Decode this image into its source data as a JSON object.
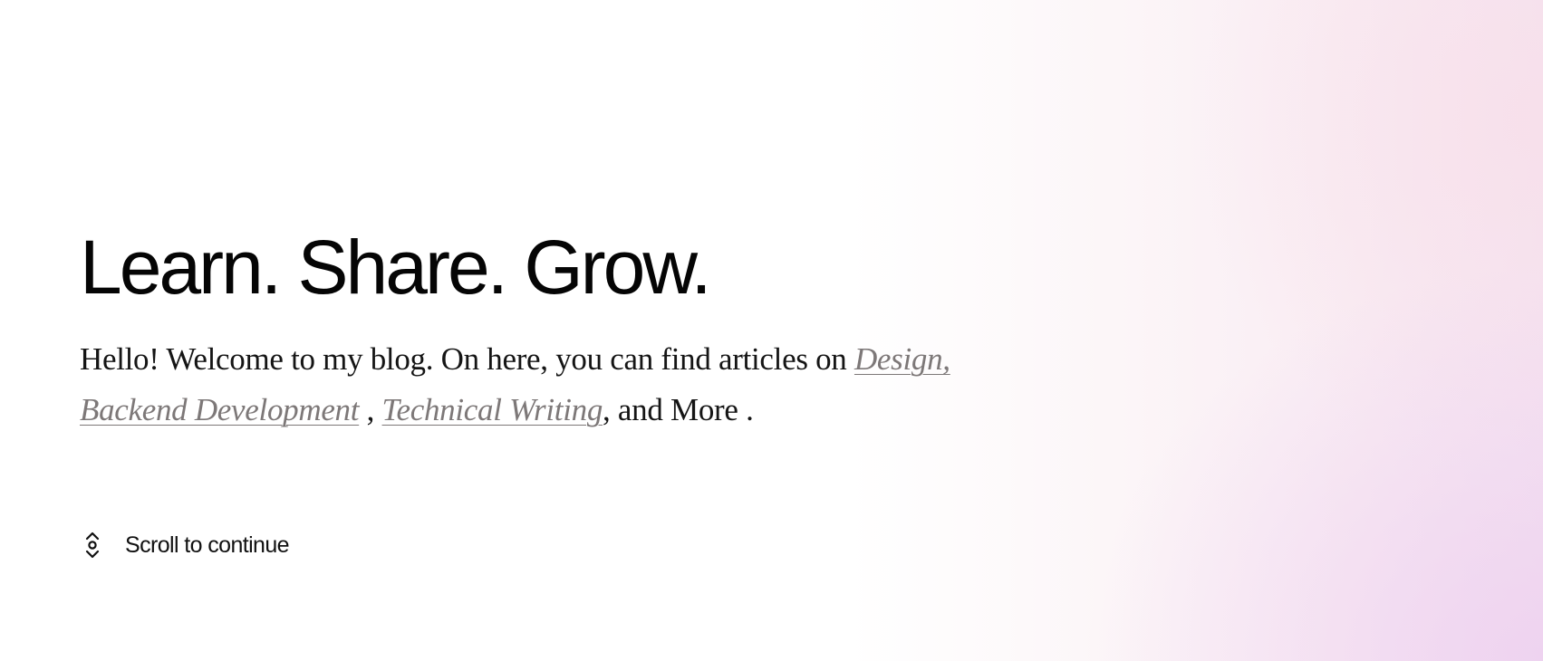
{
  "hero": {
    "headline": "Learn. Share. Grow.",
    "intro_text": "Hello! Welcome to my blog. On here, you can find articles on",
    "topics": [
      {
        "label": "Design,"
      },
      {
        "label": "Backend Development"
      },
      {
        "label": "Technical Writing"
      }
    ],
    "separator_comma": ",",
    "and_more": ", and More",
    "final_period": "."
  },
  "scroll_hint": {
    "label": "Scroll to continue",
    "icon": "scroll-icon"
  },
  "colors": {
    "text": "#0b0b0b",
    "link": "#7d7878",
    "gradient_pink": "#f9ecf3",
    "gradient_lilac": "#f5e4f1"
  }
}
